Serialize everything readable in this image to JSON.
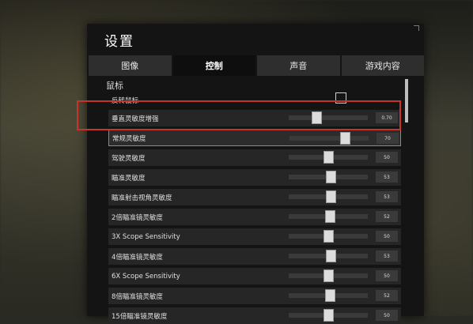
{
  "window": {
    "title": "设置"
  },
  "tabs": [
    {
      "label": "图像",
      "active": false
    },
    {
      "label": "控制",
      "active": true
    },
    {
      "label": "声音",
      "active": false
    },
    {
      "label": "游戏内容",
      "active": false
    }
  ],
  "section": {
    "title": "鼠标"
  },
  "rows": [
    {
      "label": "反转鼠标",
      "type": "checkbox",
      "checked": false
    },
    {
      "label": "垂直灵敏度增强",
      "type": "slider",
      "value": "0.70",
      "fraction": 0.35
    },
    {
      "label": "常规灵敏度",
      "type": "slider",
      "value": "70",
      "fraction": 0.7
    },
    {
      "label": "驾驶灵敏度",
      "type": "slider",
      "value": "50",
      "fraction": 0.5
    },
    {
      "label": "瞄准灵敏度",
      "type": "slider",
      "value": "53",
      "fraction": 0.53
    },
    {
      "label": "瞄准射击视角灵敏度",
      "type": "slider",
      "value": "53",
      "fraction": 0.53
    },
    {
      "label": "2倍瞄准镜灵敏度",
      "type": "slider",
      "value": "52",
      "fraction": 0.52
    },
    {
      "label": "3X Scope Sensitivity",
      "type": "slider",
      "value": "50",
      "fraction": 0.5
    },
    {
      "label": "4倍瞄准镜灵敏度",
      "type": "slider",
      "value": "53",
      "fraction": 0.53
    },
    {
      "label": "6X Scope Sensitivity",
      "type": "slider",
      "value": "50",
      "fraction": 0.5
    },
    {
      "label": "8倍瞄准镜灵敏度",
      "type": "slider",
      "value": "52",
      "fraction": 0.52
    },
    {
      "label": "15倍瞄准镜灵敏度",
      "type": "slider",
      "value": "50",
      "fraction": 0.5
    }
  ],
  "colors": {
    "highlight": "#c8342c",
    "panel": "#141414",
    "row": "#262626"
  }
}
